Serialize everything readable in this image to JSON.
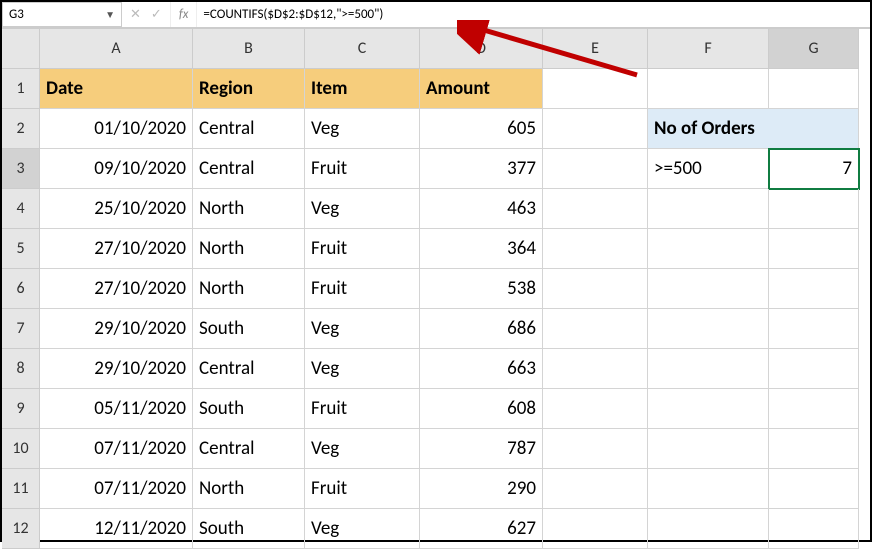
{
  "nameBox": "G3",
  "fxLabel": "fx",
  "formula": "=COUNTIFS($D$2:$D$12,\">=500\")",
  "columns": [
    "A",
    "B",
    "C",
    "D",
    "E",
    "F",
    "G"
  ],
  "rowNumbers": [
    "1",
    "2",
    "3",
    "4",
    "5",
    "6",
    "7",
    "8",
    "9",
    "10",
    "11",
    "12"
  ],
  "headers": {
    "date": "Date",
    "region": "Region",
    "item": "Item",
    "amount": "Amount"
  },
  "rows": [
    {
      "date": "01/10/2020",
      "region": "Central",
      "item": "Veg",
      "amount": "605"
    },
    {
      "date": "09/10/2020",
      "region": "Central",
      "item": "Fruit",
      "amount": "377"
    },
    {
      "date": "25/10/2020",
      "region": "North",
      "item": "Veg",
      "amount": "463"
    },
    {
      "date": "27/10/2020",
      "region": "North",
      "item": "Fruit",
      "amount": "364"
    },
    {
      "date": "27/10/2020",
      "region": "North",
      "item": "Fruit",
      "amount": "538"
    },
    {
      "date": "29/10/2020",
      "region": "South",
      "item": "Veg",
      "amount": "686"
    },
    {
      "date": "29/10/2020",
      "region": "Central",
      "item": "Veg",
      "amount": "663"
    },
    {
      "date": "05/11/2020",
      "region": "South",
      "item": "Fruit",
      "amount": "608"
    },
    {
      "date": "07/11/2020",
      "region": "Central",
      "item": "Veg",
      "amount": "787"
    },
    {
      "date": "07/11/2020",
      "region": "North",
      "item": "Fruit",
      "amount": "290"
    },
    {
      "date": "12/11/2020",
      "region": "South",
      "item": "Veg",
      "amount": "627"
    }
  ],
  "summary": {
    "title": "No of Orders",
    "criteria": ">=500",
    "result": "7"
  },
  "selectedCell": "G3"
}
